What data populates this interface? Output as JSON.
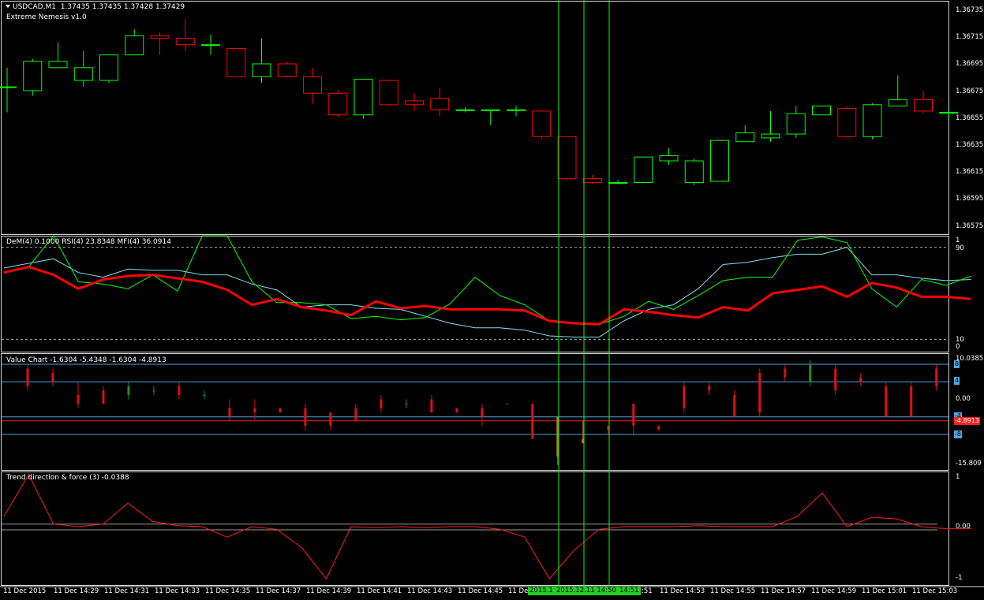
{
  "symbol": "USDCAD,M1",
  "ohlc": "1.37435 1.37435 1.37428 1.37429",
  "indicator_main": "Extreme Nemesis v1.0",
  "price_axis": [
    "1.36735",
    "1.36715",
    "1.36695",
    "1.36675",
    "1.36655",
    "1.36635",
    "1.36615",
    "1.36595",
    "1.36575"
  ],
  "osc_title": "DeM(4) 0.1000  RSI(4) 23.8348  MFI(4) 36.0914",
  "osc_axis": [
    "1",
    "90",
    "10",
    "0"
  ],
  "value_title": "Value Chart -1.6304 -5.4348 -1.6304 -4.8913",
  "value_axis": [
    "10.0385",
    "0.00",
    "-15.809"
  ],
  "value_tags": [
    "8",
    "4",
    "-4",
    "-4.8913",
    "-8"
  ],
  "trend_title": "Trend direction & force (3) -0.0388",
  "trend_axis": [
    "1",
    "0.00",
    "-1"
  ],
  "time_labels": [
    "11 Dec 2015",
    "11 Dec 14:29",
    "11 Dec 14:31",
    "11 Dec 14:33",
    "11 Dec 14:35",
    "11 Dec 14:37",
    "11 Dec 14:39",
    "11 Dec 14:41",
    "11 Dec 14:43",
    "11 Dec 14:45",
    "11 Dec",
    "2015.1",
    "2015.12.11 14:50",
    "14:51",
    ":51",
    "11 Dec 14:53",
    "11 Dec 14:55",
    "11 Dec 14:57",
    "11 Dec 14:59",
    "11 Dec 15:01",
    "11 Dec 15:03"
  ],
  "colors": {
    "bull": "#00ff00",
    "bear": "#ff0000",
    "dem": "#ff0000",
    "rsi": "#00ff00",
    "mfi": "#7fe0f0",
    "level": "#4fa6dd",
    "vline": "#00ff00",
    "vc_bull": "#1f8f1f",
    "vc_bear": "#e01010",
    "vc_dark": "#d27a1a"
  },
  "chart_data": {
    "type": "candlestick",
    "price": {
      "ylim": [
        1.36565,
        1.36745
      ],
      "candles": [
        {
          "o": 1.36675,
          "h": 1.3669,
          "l": 1.36655,
          "c": 1.36675
        },
        {
          "o": 1.36672,
          "h": 1.36697,
          "l": 1.36668,
          "c": 1.36695
        },
        {
          "o": 1.3669,
          "h": 1.3671,
          "l": 1.3669,
          "c": 1.36695
        },
        {
          "o": 1.3668,
          "h": 1.36703,
          "l": 1.36675,
          "c": 1.3669
        },
        {
          "o": 1.3668,
          "h": 1.367,
          "l": 1.36678,
          "c": 1.367
        },
        {
          "o": 1.367,
          "h": 1.3672,
          "l": 1.367,
          "c": 1.36715
        },
        {
          "o": 1.36715,
          "h": 1.36718,
          "l": 1.367,
          "c": 1.36713
        },
        {
          "o": 1.36713,
          "h": 1.36728,
          "l": 1.36703,
          "c": 1.36708
        },
        {
          "o": 1.36708,
          "h": 1.36716,
          "l": 1.367,
          "c": 1.36708
        },
        {
          "o": 1.36705,
          "h": 1.36705,
          "l": 1.36683,
          "c": 1.36683
        },
        {
          "o": 1.36683,
          "h": 1.36713,
          "l": 1.36678,
          "c": 1.36693
        },
        {
          "o": 1.36693,
          "h": 1.36695,
          "l": 1.36683,
          "c": 1.36683
        },
        {
          "o": 1.36683,
          "h": 1.3669,
          "l": 1.36662,
          "c": 1.3667
        },
        {
          "o": 1.3667,
          "h": 1.36673,
          "l": 1.36651,
          "c": 1.36653
        },
        {
          "o": 1.36653,
          "h": 1.36681,
          "l": 1.3665,
          "c": 1.36681
        },
        {
          "o": 1.3668,
          "h": 1.3668,
          "l": 1.3666,
          "c": 1.36661
        },
        {
          "o": 1.36664,
          "h": 1.3667,
          "l": 1.36656,
          "c": 1.36661
        },
        {
          "o": 1.36666,
          "h": 1.36674,
          "l": 1.36652,
          "c": 1.36657
        },
        {
          "o": 1.36657,
          "h": 1.36659,
          "l": 1.36655,
          "c": 1.36657
        },
        {
          "o": 1.36657,
          "h": 1.36657,
          "l": 1.36645,
          "c": 1.36657
        },
        {
          "o": 1.36657,
          "h": 1.3666,
          "l": 1.36652,
          "c": 1.36657
        },
        {
          "o": 1.36656,
          "h": 1.36656,
          "l": 1.36634,
          "c": 1.36636
        },
        {
          "o": 1.36636,
          "h": 1.36636,
          "l": 1.36602,
          "c": 1.36603
        },
        {
          "o": 1.36603,
          "h": 1.36606,
          "l": 1.36599,
          "c": 1.366
        },
        {
          "o": 1.366,
          "h": 1.36602,
          "l": 1.366,
          "c": 1.366
        },
        {
          "o": 1.366,
          "h": 1.3662,
          "l": 1.366,
          "c": 1.3662
        },
        {
          "o": 1.36617,
          "h": 1.36627,
          "l": 1.36614,
          "c": 1.36621
        },
        {
          "o": 1.366,
          "h": 1.36619,
          "l": 1.36598,
          "c": 1.36617
        },
        {
          "o": 1.36601,
          "h": 1.36633,
          "l": 1.36601,
          "c": 1.36633
        },
        {
          "o": 1.36632,
          "h": 1.36645,
          "l": 1.36632,
          "c": 1.36639
        },
        {
          "o": 1.36635,
          "h": 1.36656,
          "l": 1.36632,
          "c": 1.36638
        },
        {
          "o": 1.36638,
          "h": 1.3666,
          "l": 1.36635,
          "c": 1.36654
        },
        {
          "o": 1.36653,
          "h": 1.3666,
          "l": 1.36653,
          "c": 1.3666
        },
        {
          "o": 1.36658,
          "h": 1.3666,
          "l": 1.36636,
          "c": 1.36636
        },
        {
          "o": 1.36636,
          "h": 1.36662,
          "l": 1.36634,
          "c": 1.36661
        },
        {
          "o": 1.3666,
          "h": 1.36684,
          "l": 1.3666,
          "c": 1.36665
        },
        {
          "o": 1.36665,
          "h": 1.36672,
          "l": 1.36654,
          "c": 1.36656
        },
        {
          "o": 1.36655,
          "h": 1.36658,
          "l": 1.3665,
          "c": 1.36655
        }
      ]
    },
    "oscillator": {
      "ylim": [
        0,
        100
      ],
      "dem": [
        68,
        73,
        66,
        54,
        62,
        65,
        66,
        63,
        60,
        53,
        40,
        45,
        38,
        35,
        31,
        43,
        37,
        39,
        36,
        36,
        36,
        35,
        26,
        24,
        23,
        36,
        34,
        31,
        29,
        38,
        35,
        50,
        53,
        56,
        47,
        59,
        55,
        47,
        47,
        45
      ],
      "rsi": [
        68,
        73,
        100,
        60,
        58,
        54,
        66,
        52,
        100,
        100,
        60,
        42,
        42,
        40,
        28,
        30,
        27,
        29,
        41,
        64,
        48,
        40,
        26,
        24,
        23,
        30,
        43,
        36,
        48,
        61,
        64,
        64,
        96,
        99,
        94,
        54,
        38,
        62,
        57,
        65
      ],
      "mfi": [
        72,
        76,
        80,
        68,
        64,
        71,
        70,
        70,
        66,
        66,
        58,
        53,
        38,
        40,
        40,
        37,
        36,
        30,
        24,
        20,
        20,
        18,
        13,
        12,
        12,
        26,
        36,
        40,
        54,
        75,
        77,
        81,
        84,
        84,
        90,
        66,
        66,
        63,
        61,
        62
      ]
    },
    "value_chart": {
      "ylim": [
        -15.809,
        10.0385
      ],
      "levels": [
        8,
        4,
        -4,
        -8
      ],
      "current": -4.8913,
      "bars": [
        {
          "h": 8,
          "l": 2,
          "o": 7,
          "c": 3
        },
        {
          "h": 7,
          "l": 3,
          "o": 6,
          "c": 4
        },
        {
          "h": 4,
          "l": -2,
          "o": 1,
          "c": -1
        },
        {
          "h": 3,
          "l": -1,
          "o": 2,
          "c": -1
        },
        {
          "h": 4,
          "l": 0,
          "o": 1,
          "c": 3
        },
        {
          "h": 3,
          "l": 1,
          "o": 2,
          "c": 2
        },
        {
          "h": 4,
          "l": 0,
          "o": 3,
          "c": 1
        },
        {
          "h": 2,
          "l": 0,
          "o": 1,
          "c": 1
        },
        {
          "h": 0,
          "l": -5,
          "o": -2,
          "c": -4
        },
        {
          "h": 0,
          "l": -5,
          "o": -2,
          "c": -3
        },
        {
          "h": -2,
          "l": -3,
          "o": -2,
          "c": -3
        },
        {
          "h": -1,
          "l": -7,
          "o": -2,
          "c": -6
        },
        {
          "h": -3,
          "l": -7,
          "o": -3,
          "c": -6
        },
        {
          "h": -1,
          "l": -5,
          "o": -2,
          "c": -5
        },
        {
          "h": 1,
          "l": -3,
          "o": 0,
          "c": -2
        },
        {
          "h": 0,
          "l": -2,
          "o": -1,
          "c": -1
        },
        {
          "h": 1,
          "l": -3,
          "o": 0,
          "c": -3
        },
        {
          "h": -2,
          "l": -3,
          "o": -2,
          "c": -3
        },
        {
          "h": -1,
          "l": -6,
          "o": -2,
          "c": -4
        },
        {
          "h": -1,
          "l": -1,
          "o": -1,
          "c": -1
        },
        {
          "h": -1,
          "l": -9,
          "o": -1,
          "c": -9
        },
        {
          "h": -4,
          "l": -15,
          "o": -4,
          "c": -13
        },
        {
          "h": -5,
          "l": -10,
          "o": -9,
          "c": -10
        },
        {
          "h": -6,
          "l": -8,
          "o": -6,
          "c": -7
        },
        {
          "h": -1,
          "l": -8,
          "o": -1,
          "c": -6
        },
        {
          "h": -6,
          "l": -7,
          "o": -6,
          "c": -7
        },
        {
          "h": 4,
          "l": -3,
          "o": 3,
          "c": -2
        },
        {
          "h": 4,
          "l": 1,
          "o": 3,
          "c": 2
        },
        {
          "h": 2,
          "l": -4,
          "o": 1,
          "c": -4
        },
        {
          "h": 7,
          "l": -4,
          "o": 6,
          "c": -3
        },
        {
          "h": 8,
          "l": 4,
          "o": 7,
          "c": 5
        },
        {
          "h": 9,
          "l": 3,
          "o": 4,
          "c": 8
        },
        {
          "h": 8,
          "l": 1,
          "o": 7,
          "c": 2
        },
        {
          "h": 6,
          "l": 3,
          "o": 5,
          "c": 4
        },
        {
          "h": 4,
          "l": -4,
          "o": 3,
          "c": -4
        },
        {
          "h": 4,
          "l": -4,
          "o": 3,
          "c": -4
        },
        {
          "h": 8,
          "l": 2,
          "o": 7,
          "c": 3
        },
        {
          "h": 4,
          "l": -1,
          "o": 3,
          "c": -1
        },
        {
          "h": 0,
          "l": -2,
          "o": -1,
          "c": -2
        }
      ]
    },
    "trend": {
      "ylim": [
        -1,
        1
      ],
      "zero_band": [
        0.05,
        -0.06
      ],
      "values": [
        0.2,
        1.0,
        0.05,
        0.0,
        0.05,
        0.45,
        0.1,
        0.02,
        0.0,
        -0.2,
        0.0,
        -0.05,
        -0.4,
        -1.0,
        0.0,
        -0.02,
        0.0,
        -0.02,
        0.0,
        0.0,
        -0.05,
        -0.2,
        -1.0,
        -0.45,
        -0.05,
        0.0,
        0.0,
        0.0,
        0.02,
        0.0,
        0.0,
        0.0,
        0.2,
        0.65,
        0.0,
        0.18,
        0.15,
        0.0,
        -0.04,
        -0.04
      ]
    }
  }
}
